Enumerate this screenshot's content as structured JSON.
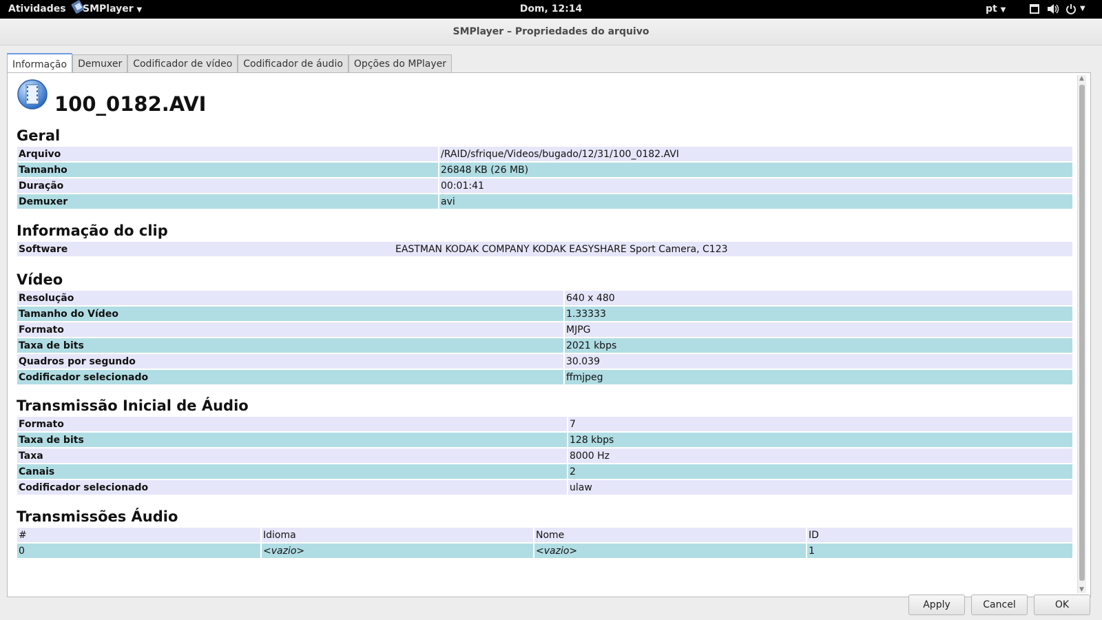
{
  "topbar": {
    "activities": "Atividades",
    "app": "SMPlayer",
    "clock": "Dom, 12:14",
    "lang": "pt"
  },
  "window": {
    "title": "SMPlayer – Propriedades do arquivo"
  },
  "tabs": [
    {
      "label": "Informação",
      "active": true
    },
    {
      "label": "Demuxer"
    },
    {
      "label": "Codificador de vídeo"
    },
    {
      "label": "Codificador de áudio"
    },
    {
      "label": "Opções do MPlayer"
    }
  ],
  "file": {
    "name": "100_0182.AVI"
  },
  "general": {
    "title": "Geral",
    "rows": [
      {
        "k": "Arquivo",
        "v": "/RAID/sfrique/Videos/bugado/12/31/100_0182.AVI"
      },
      {
        "k": "Tamanho",
        "v": "26848 KB (26 MB)"
      },
      {
        "k": "Duração",
        "v": "00:01:41"
      },
      {
        "k": "Demuxer",
        "v": "avi"
      }
    ]
  },
  "clip": {
    "title": "Informação do clip",
    "rows": [
      {
        "k": "Software",
        "v": "EASTMAN KODAK COMPANY KODAK EASYSHARE Sport Camera, C123"
      }
    ]
  },
  "video": {
    "title": "Vídeo",
    "rows": [
      {
        "k": "Resolução",
        "v": "640 x 480"
      },
      {
        "k": "Tamanho do Vídeo",
        "v": "1.33333"
      },
      {
        "k": "Formato",
        "v": "MJPG"
      },
      {
        "k": "Taxa de bits",
        "v": "2021 kbps"
      },
      {
        "k": "Quadros por segundo",
        "v": "30.039"
      },
      {
        "k": "Codificador selecionado",
        "v": "ffmjpeg"
      }
    ]
  },
  "audio": {
    "title": "Transmissão Inicial de Áudio",
    "rows": [
      {
        "k": "Formato",
        "v": "7"
      },
      {
        "k": "Taxa de bits",
        "v": "128 kbps"
      },
      {
        "k": "Taxa",
        "v": "8000 Hz"
      },
      {
        "k": "Canais",
        "v": "2"
      },
      {
        "k": "Codificador selecionado",
        "v": "ulaw"
      }
    ]
  },
  "streams": {
    "title": "Transmissões Áudio",
    "headers": [
      "#",
      "Idioma",
      "Nome",
      "ID"
    ],
    "rows": [
      [
        "0",
        "<vazio>",
        "<vazio>",
        "1"
      ]
    ]
  },
  "buttons": {
    "apply": "Apply",
    "cancel": "Cancel",
    "ok": "OK"
  }
}
